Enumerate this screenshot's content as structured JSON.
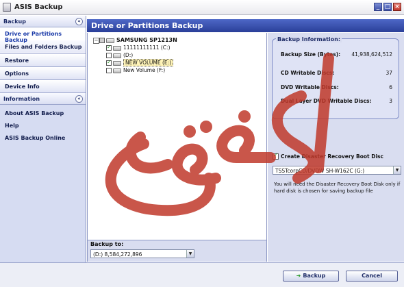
{
  "window": {
    "title": "ASIS Backup"
  },
  "sidebar": {
    "backup_header": "Backup",
    "backup_items": [
      "Drive or Partitions Backup",
      "Files and Folders Backup"
    ],
    "other_items": [
      "Restore",
      "Options",
      "Device Info"
    ],
    "information_header": "Information",
    "information_items": [
      "About ASIS Backup",
      "Help",
      "ASIS Backup Online"
    ]
  },
  "main": {
    "header": "Drive or Partitions Backup",
    "tree": {
      "disk": "SAMSUNG SP1213N",
      "partitions": [
        {
          "label": "11111111111 (C:)",
          "checked": true
        },
        {
          "label": "(D:)",
          "checked": false
        },
        {
          "label": "NEW VOLUME (E:)",
          "checked": true
        },
        {
          "label": "New Volume (F:)",
          "checked": false
        }
      ]
    },
    "backup_to": {
      "label": "Backup to:",
      "value": "(D:) 8,584,272,896"
    }
  },
  "info": {
    "title": "Backup Information:",
    "rows": [
      {
        "label": "Backup Size (Bytes):",
        "value": "41,938,624,512"
      },
      {
        "label": "CD Writable Discs:",
        "value": "37"
      },
      {
        "label": "DVD Writable Discs:",
        "value": "6"
      },
      {
        "label": "Dual Layer DVD Writable Discs:",
        "value": "3"
      }
    ]
  },
  "recovery": {
    "checkbox_label": "Create Disaster Recovery Boot Disc",
    "drive_value": "TSSTcorpCD/DVDW SH-W162C (G:)",
    "note": "You will need the Disaster Recovery Boot Disk only if hard disk is chosen for saving backup file"
  },
  "buttons": {
    "backup": "Backup",
    "cancel": "Cancel"
  },
  "colors": {
    "header_blue": "#2a3f98",
    "sidebar_bg": "#d6dcf2",
    "watermark": "#c0392b"
  }
}
